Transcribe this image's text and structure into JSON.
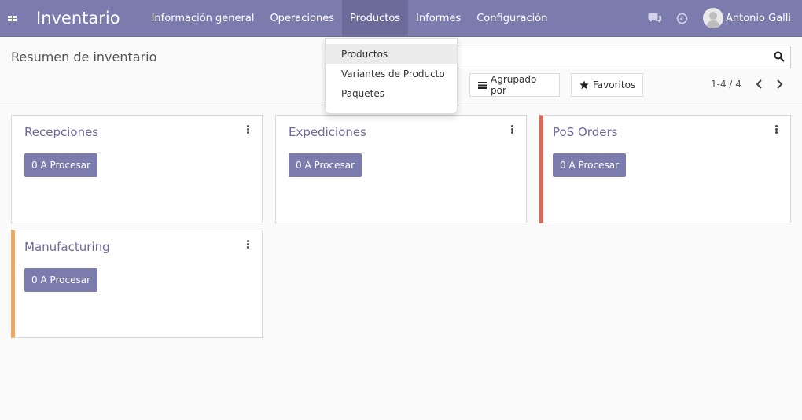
{
  "app": {
    "brand": "Inventario"
  },
  "nav": {
    "items": [
      {
        "label": "Información general"
      },
      {
        "label": "Operaciones"
      },
      {
        "label": "Productos"
      },
      {
        "label": "Informes"
      },
      {
        "label": "Configuración"
      }
    ],
    "active_index": 2
  },
  "user": {
    "name": "Antonio Galli"
  },
  "control_panel": {
    "title": "Resumen de inventario",
    "search": {
      "value": ""
    },
    "group_by_label": "Agrupado por",
    "favorites_label": "Favoritos",
    "pager": "1-4 / 4"
  },
  "dropdown": {
    "items": [
      {
        "label": "Productos"
      },
      {
        "label": "Variantes de Producto"
      },
      {
        "label": "Paquetes"
      }
    ]
  },
  "cards": [
    {
      "title": "Recepciones",
      "button": "0 A Procesar"
    },
    {
      "title": "Expediciones",
      "button": "0 A Procesar"
    },
    {
      "title": "PoS Orders",
      "button": "0 A Procesar",
      "accent": "#d96b56"
    },
    {
      "title": "Manufacturing",
      "button": "0 A Procesar",
      "accent": "#eda960"
    }
  ],
  "colors": {
    "primary": "#7c7bad",
    "active_menu": "#6c6b99"
  }
}
